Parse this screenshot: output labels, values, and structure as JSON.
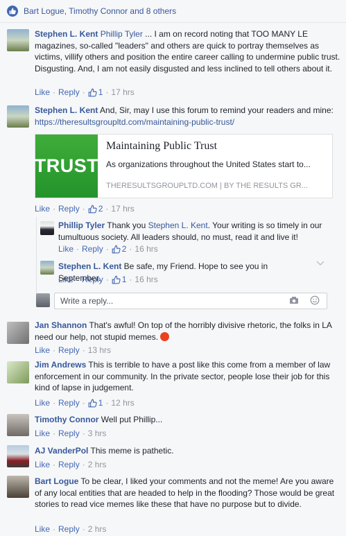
{
  "likes_summary": "Bart Logue, Timothy Connor and 8 others",
  "actions": {
    "like": "Like",
    "reply": "Reply"
  },
  "comments": [
    {
      "name": "Stephen L. Kent",
      "mention": "Phillip Tyler",
      "text": " ... I am on record noting that TOO MANY LE magazines, so-called \"leaders\" and others are quick to portray themselves as victims, villify others and position the entire career calling to undermine public trust. Disgusting. And, I am not easily disgusted and less inclined to tell others about it.",
      "likes": "1",
      "time": "17 hrs"
    },
    {
      "name": "Stephen L. Kent",
      "text": " And, Sir, may I use this forum to remind your readers and mine: ",
      "link": "https://theresultsgroupltd.com/maintaining-public-trust/",
      "likes": "2",
      "time": "17 hrs",
      "card": {
        "thumb_text": "TRUST",
        "title": "Maintaining Public Trust",
        "desc": "As organizations throughout the United States start to...",
        "source": "THERESULTSGROUPLTD.COM",
        "by": "BY THE RESULTS GR...",
        "sep": "|"
      }
    },
    {
      "name": "Phillip Tyler",
      "text": " Thank you ",
      "mention": "Stephen L. Kent",
      "text2": ". Your writing is so timely in our tumultuous society. All leaders should, no must, read it and live it!",
      "likes": "2",
      "time": "16 hrs"
    },
    {
      "name": "Stephen L. Kent",
      "text": " Be safe, my Friend. Hope to see you in September.",
      "likes": "1",
      "time": "16 hrs"
    },
    {
      "name": "Jan Shannon",
      "text": " That's awful! On top of the horribly divisive rhetoric, the folks in LA need our help, not stupid memes. ",
      "time": "13 hrs"
    },
    {
      "name": "Jim Andrews",
      "text": " This is terrible to have a post like this come from a member of law enforcement in our community. In the private sector, people lose their job for this kind of lapse in judgement.",
      "likes": "1",
      "time": "12 hrs"
    },
    {
      "name": "Timothy Connor",
      "text": " Well put Phillip...",
      "time": "3 hrs"
    },
    {
      "name": "AJ VanderPol",
      "text": " This meme is pathetic.",
      "time": "2 hrs"
    },
    {
      "name": "Bart Logue",
      "text": " To be clear, I liked your comments and not the meme! Are you aware of any local entities that are headed to help in the flooding? Those would be great stories to read vice memes like these that have no purpose but to divide.",
      "time": "2 hrs"
    }
  ],
  "reply_placeholder": "Write a reply...",
  "colors": {
    "link": "#365899",
    "meta": "#90949c",
    "accent": "#4267b2",
    "trust_green": "#2fa535"
  }
}
